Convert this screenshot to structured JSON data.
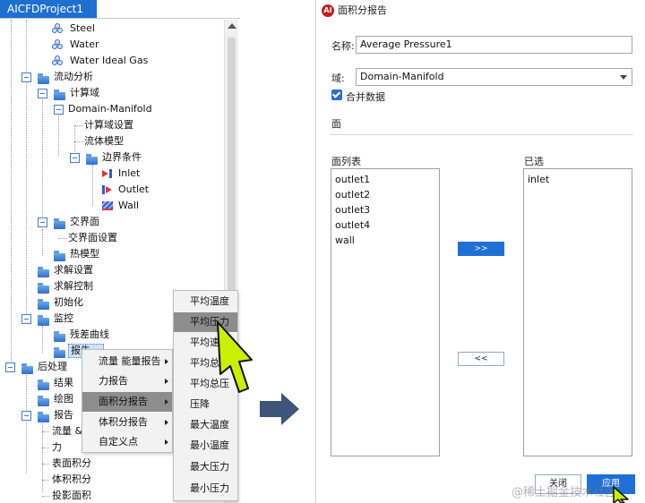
{
  "project_tab": "AICFDProject1",
  "tree": {
    "steel": "Steel",
    "water": "Water",
    "water_ideal_gas": "Water Ideal Gas",
    "flow_analysis": "流动分析",
    "domain": "计算域",
    "domain_manifold": "Domain-Manifold",
    "domain_settings": "计算域设置",
    "fluid_model": "流体模型",
    "boundary_conditions": "边界条件",
    "inlet": "Inlet",
    "outlet": "Outlet",
    "wall": "Wall",
    "interface": "交界面",
    "interface_settings": "交界面设置",
    "thermal_model": "热模型",
    "solver_settings": "求解设置",
    "solver_control": "求解控制",
    "initialization": "初始化",
    "monitor": "监控",
    "residual_curve": "残差曲线",
    "report": "报告",
    "postprocess": "后处理",
    "results": "结果",
    "plots": "绘图",
    "reports": "报告",
    "flow_and": "流量 &",
    "force": "力",
    "surface_integral": "表面积分",
    "volume_integral": "体积积分",
    "projected_area": "投影面积"
  },
  "context_menu": {
    "items": [
      "流量  能量报告",
      "力报告",
      "面积分报告",
      "体积分报告",
      "自定义点"
    ],
    "highlighted": "面积分报告"
  },
  "submenu": {
    "items": [
      "平均温度",
      "平均压力",
      "平均速",
      "平均总",
      "平均总压",
      "压降",
      "最大温度",
      "最小温度",
      "最大压力",
      "最小压力"
    ],
    "highlighted": "平均压力"
  },
  "dialog": {
    "title": "面积分报告",
    "name_label": "名称:",
    "name_value": "Average Pressure1",
    "domain_label": "域:",
    "domain_value": "Domain-Manifold",
    "merge_label": "合并数据",
    "merge_checked": true,
    "surface_section": "面",
    "surface_list_label": "面列表",
    "selected_label": "已选",
    "surface_list": [
      "outlet1",
      "outlet2",
      "outlet3",
      "outlet4",
      "wall"
    ],
    "selected_list": [
      "inlet"
    ],
    "add_button": ">>",
    "remove_button": "<<",
    "close_button": "关闭",
    "apply_button": "应用"
  },
  "watermark": "@稀土掘金技术社区",
  "colors": {
    "accent": "#1f70d6",
    "tab": "#1e6fd0",
    "cursor": "#c8f000",
    "arrow": "#3e5478"
  }
}
